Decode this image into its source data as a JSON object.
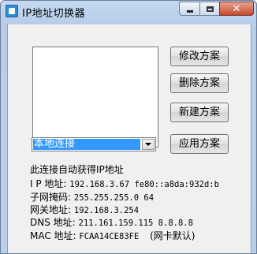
{
  "window": {
    "title": "IP地址切换器"
  },
  "buttons": {
    "edit": "修改方案",
    "delete": "删除方案",
    "new": "新建方案",
    "apply": "应用方案"
  },
  "connection_select": {
    "selected": "本地连接"
  },
  "info": {
    "status": "此连接自动获得IP地址",
    "ip_label": "I P 地址:",
    "ip_value": "192.168.3.67  fe80::a8da:932d:b",
    "mask_label": "子网掩码:",
    "mask_value": "255.255.255.0  64",
    "gateway_label": "网关地址:",
    "gateway_value": "192.168.3.254",
    "dns_label": "DNS 地址:",
    "dns_value": "211.161.159.115  8.8.8.8",
    "mac_label": "MAC 地址:",
    "mac_value": "FCAA14CE83FE",
    "mac_note": "(网卡默认)"
  }
}
